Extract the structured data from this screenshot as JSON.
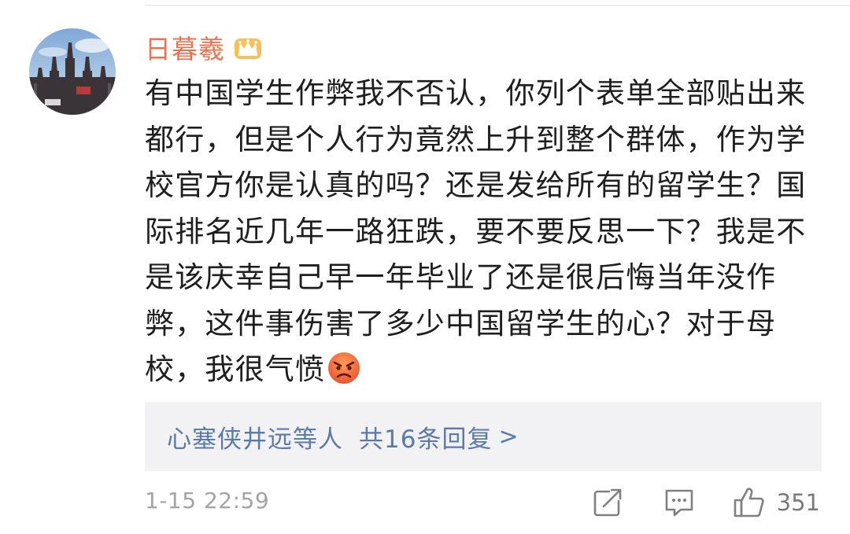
{
  "comment": {
    "username": "日暮羲",
    "badge_icon": "crown-icon",
    "lines": [
      "有中国学生作弊我不否认，你列个表单全部贴出来",
      "都行，但是个人行为竟然上升到整个群体，作为学",
      "校官方你是认真的吗？还是发给所有的留学生？国",
      "际排名近几年一路狂跌，要不要反思一下？我是不",
      "是该庆幸自己早一年毕业了还是很后悔当年没作",
      "弊，这件事伤害了多少中国留学生的心？对于母",
      "校，我很气愤"
    ],
    "emoji": "angry-face-icon",
    "timestamp": "1-15 22:59"
  },
  "replies": {
    "participants": "心塞侠井远等人",
    "count_label": "共16条回复",
    "arrow": ">"
  },
  "actions": {
    "share_icon": "share-icon",
    "comment_icon": "comment-icon",
    "like_icon": "thumbs-up-icon",
    "like_count": "351"
  },
  "colors": {
    "username": "#eb7350",
    "link": "#5b7aa8",
    "text": "#1e1e1e",
    "muted": "#a4a4a4",
    "reply_bg": "#f2f2f4"
  }
}
